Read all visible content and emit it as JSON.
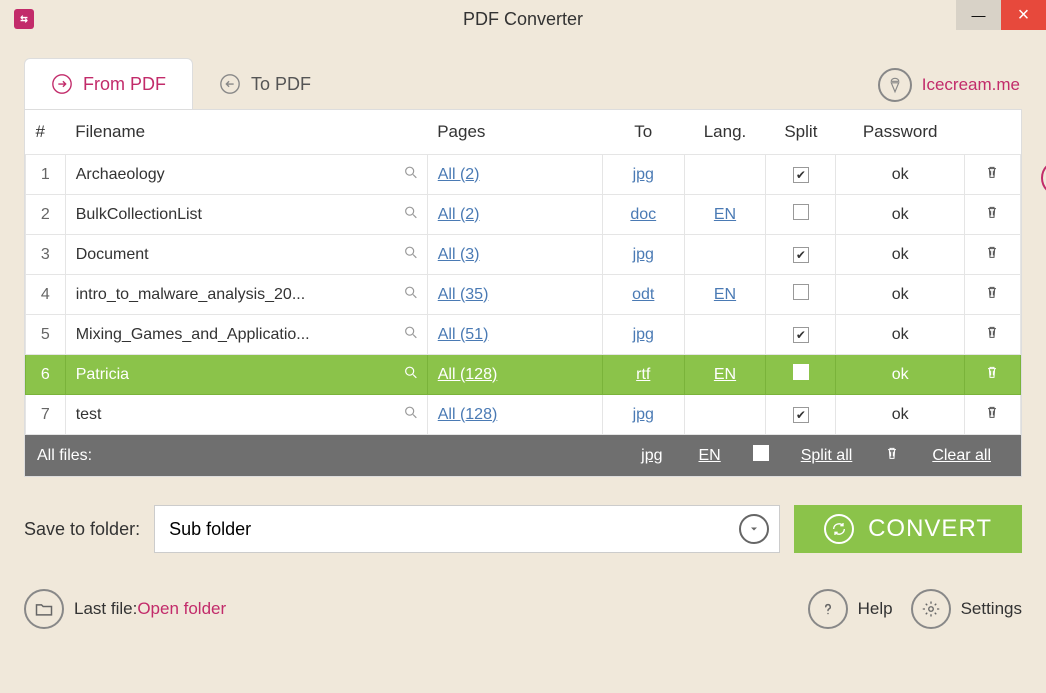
{
  "title": "PDF Converter",
  "tabs": {
    "from": "From PDF",
    "to": "To PDF"
  },
  "brand": "Icecream.me",
  "columns": {
    "num": "#",
    "filename": "Filename",
    "pages": "Pages",
    "to": "To",
    "lang": "Lang.",
    "split": "Split",
    "password": "Password"
  },
  "rows": [
    {
      "n": "1",
      "name": "Archaeology",
      "pages": "All (2)",
      "to": "jpg",
      "lang": "",
      "split": true,
      "pwd": "ok",
      "selected": false
    },
    {
      "n": "2",
      "name": "BulkCollectionList",
      "pages": "All (2)",
      "to": "doc",
      "lang": "EN",
      "split": false,
      "pwd": "ok",
      "selected": false
    },
    {
      "n": "3",
      "name": "Document",
      "pages": "All (3)",
      "to": "jpg",
      "lang": "",
      "split": true,
      "pwd": "ok",
      "selected": false
    },
    {
      "n": "4",
      "name": "intro_to_malware_analysis_20...",
      "pages": "All (35)",
      "to": "odt",
      "lang": "EN",
      "split": false,
      "pwd": "ok",
      "selected": false
    },
    {
      "n": "5",
      "name": "Mixing_Games_and_Applicatio...",
      "pages": "All (51)",
      "to": "jpg",
      "lang": "",
      "split": true,
      "pwd": "ok",
      "selected": false
    },
    {
      "n": "6",
      "name": "Patricia",
      "pages": "All (128)",
      "to": "rtf",
      "lang": "EN",
      "split": false,
      "pwd": "ok",
      "selected": true
    },
    {
      "n": "7",
      "name": "test",
      "pages": "All (128)",
      "to": "jpg",
      "lang": "",
      "split": true,
      "pwd": "ok",
      "selected": false
    }
  ],
  "summary": {
    "label": "All files:",
    "to": "jpg",
    "lang": "EN",
    "split_all": "Split all",
    "clear_all": "Clear all"
  },
  "save": {
    "label": "Save to folder:",
    "value": "Sub folder"
  },
  "convert": "CONVERT",
  "footer": {
    "last_label": "Last file: ",
    "open": "Open folder",
    "help": "Help",
    "settings": "Settings"
  }
}
